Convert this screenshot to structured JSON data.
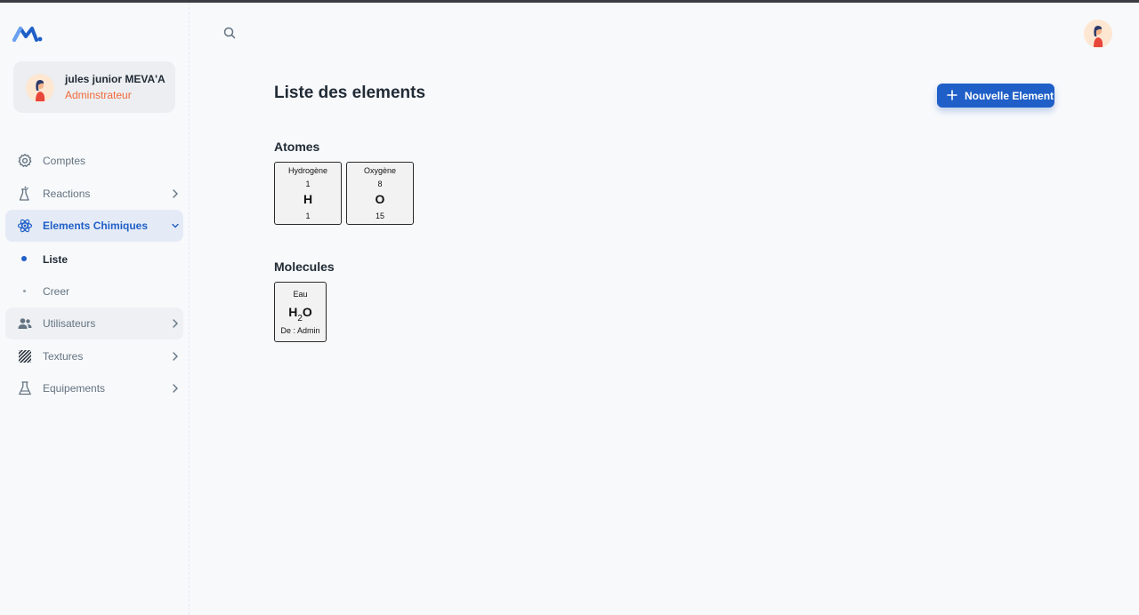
{
  "sidebar": {
    "account": {
      "name": "jules junior MEVA'A",
      "role": "Adminstrateur"
    },
    "items": [
      {
        "label": "Comptes",
        "icon": "gear-icon"
      },
      {
        "label": "Reactions",
        "icon": "reaction-icon"
      },
      {
        "label": "Elements Chimiques",
        "icon": "atom-icon"
      },
      {
        "label": "Utilisateurs",
        "icon": "users-icon"
      },
      {
        "label": "Textures",
        "icon": "texture-icon"
      },
      {
        "label": "Equipements",
        "icon": "flask-icon"
      }
    ],
    "subitems": [
      {
        "label": "Liste"
      },
      {
        "label": "Creer"
      }
    ]
  },
  "main": {
    "title": "Liste des elements",
    "new_button": "Nouvelle Element",
    "atoms_title": "Atomes",
    "atoms": [
      {
        "name": "Hydrogène",
        "number": "1",
        "symbol": "H",
        "mass": "1"
      },
      {
        "name": "Oxygène",
        "number": "8",
        "symbol": "O",
        "mass": "15"
      }
    ],
    "molecules_title": "Molecules",
    "molecules": [
      {
        "name": "Eau",
        "formula_a": "H",
        "formula_sub": "2",
        "formula_b": "O",
        "author": "De : Admin"
      }
    ]
  },
  "colors": {
    "accent": "#1f5fc7",
    "role": "#f0693a"
  }
}
